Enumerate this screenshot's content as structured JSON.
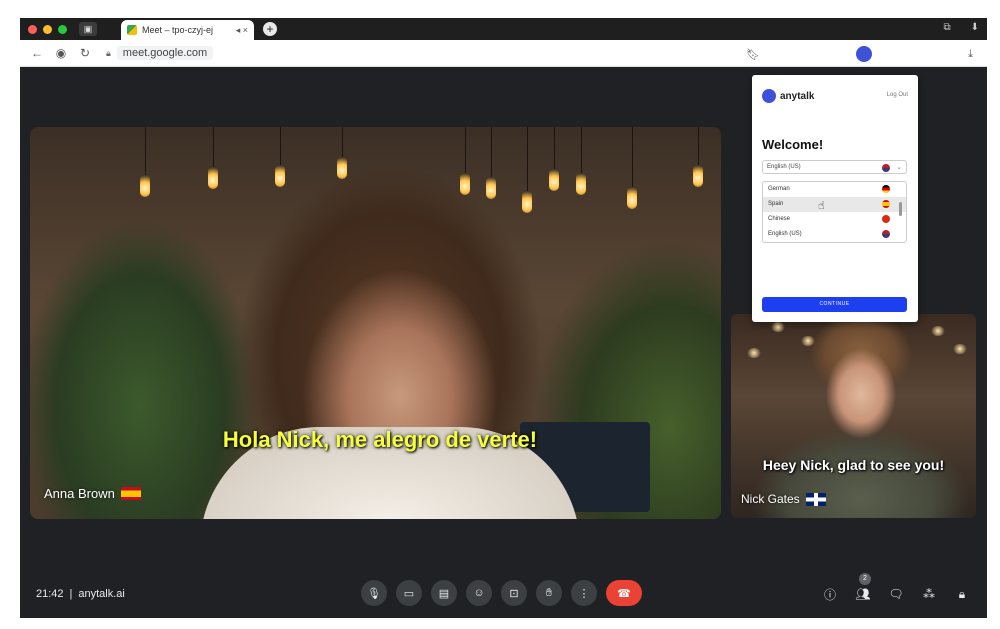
{
  "browser": {
    "tab_title": "Meet – tpo-czyj-ej",
    "tab_controls": "◂ ×",
    "newtab_glyph": "+",
    "url": "meet.google.com"
  },
  "main_video": {
    "participant": "Anna Brown",
    "caption": "Hola Nick, me alegro de verte!",
    "flag": "spain-flag-icon"
  },
  "side_video": {
    "participant": "Nick Gates",
    "caption": "Heey Nick, glad to see you!",
    "flag": "uk-flag-icon"
  },
  "anytalk": {
    "brand": "anytalk",
    "logout": "Log Out",
    "welcome": "Welcome!",
    "selected_language": "English (US)",
    "options": [
      {
        "label": "German"
      },
      {
        "label": "Spain"
      },
      {
        "label": "Chinese"
      },
      {
        "label": "English (US)"
      }
    ],
    "continue_label": "CONTINUE"
  },
  "meeting": {
    "time": "21:42",
    "separator": "|",
    "code": "anytalk.ai",
    "participants_count": "2"
  },
  "colors": {
    "caption_main": "#f6ff3a",
    "end_call": "#ea4335",
    "anytalk_accent": "#1e3ff0"
  }
}
